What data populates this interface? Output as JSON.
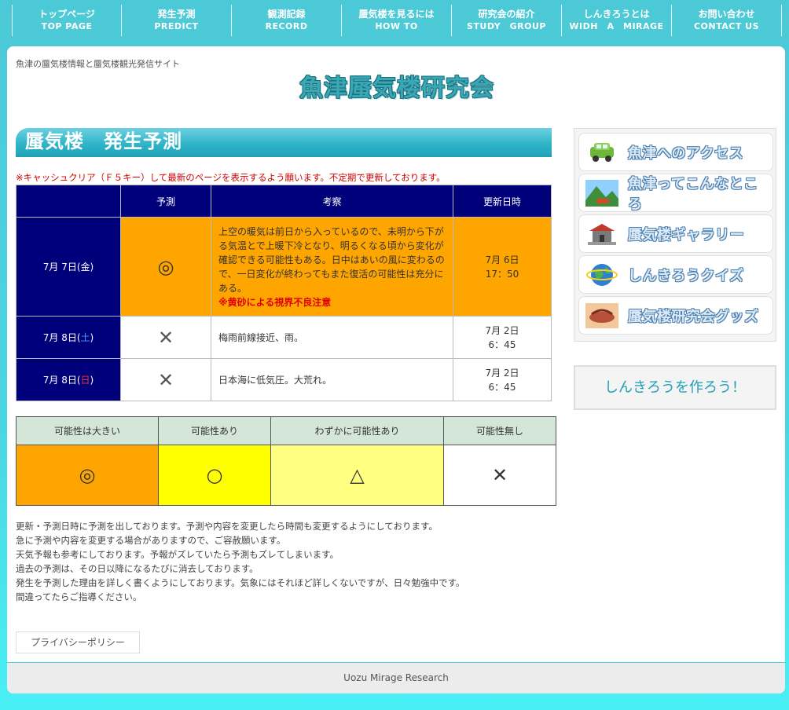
{
  "nav": [
    {
      "jp": "トップページ",
      "en": "TOP PAGE"
    },
    {
      "jp": "発生予測",
      "en": "PREDICT"
    },
    {
      "jp": "観測記録",
      "en": "RECORD"
    },
    {
      "jp": "蜃気楼を見るには",
      "en": "HOW TO"
    },
    {
      "jp": "研究会の紹介",
      "en": "STUDY　GROUP"
    },
    {
      "jp": "しんきろうとは",
      "en": "WIDH　A　MIRAGE"
    },
    {
      "jp": "お問い合わせ",
      "en": "CONTACT US"
    }
  ],
  "tagline": "魚津の蜃気楼情報と蜃気楼観光発信サイト",
  "logo_text": "魚津蜃気楼研究会",
  "section_title": "蜃気楼　発生予測",
  "cache_notice": "※キャッシュクリア（Ｆ５キー）して最新のページを表示するよう願います。不定期で更新しております。",
  "forecast": {
    "headers": [
      "",
      "予測",
      "考察",
      "更新日時"
    ],
    "rows": [
      {
        "date_prefix": "7月 7日(",
        "weekday": "金",
        "date_suffix": ")",
        "mark": "◎",
        "desc": "上空の暖気は前日から入っているので、未明から下がる気温とで上暖下冷となり、明るくなる頃から変化が確認できる可能性もある。日中はあいの風に変わるので、一日変化が終わってもまた復活の可能性は充分にある。",
        "warning": "※黄砂による視界不良注意",
        "updated_date": "7月 6日",
        "updated_time": "17：50"
      },
      {
        "date_prefix": "7月 8日(",
        "weekday": "土",
        "date_suffix": ")",
        "mark": "✕",
        "desc": "梅雨前線接近、雨。",
        "updated_date": "7月 2日",
        "updated_time": "6：45"
      },
      {
        "date_prefix": "7月 8日(",
        "weekday": "日",
        "date_suffix": ")",
        "mark": "✕",
        "desc": "日本海に低気圧。大荒れ。",
        "updated_date": "7月 2日",
        "updated_time": "6：45"
      }
    ]
  },
  "legend": {
    "headers": [
      "可能性は大きい",
      "可能性あり",
      "わずかに可能性あり",
      "可能性無し"
    ],
    "marks": [
      "◎",
      "○",
      "△",
      "✕"
    ],
    "colors": [
      "#ffa500",
      "#ffff00",
      "#ffff80",
      "#ffffff"
    ]
  },
  "notes": [
    "更新・予測日時に予測を出しております。予測や内容を変更したら時間も変更するようにしております。",
    "急に予測や内容を変更する場合がありますので、ご容赦願います。",
    "天気予報も参考にしております。予報がズレていたら予測もズレてしまいます。",
    "過去の予測は、その日以降になるたびに消去しております。",
    "発生を予測した理由を詳しく書くようにしております。気象にはそれほど詳しくないですが、日々勉強中です。",
    "間違ってたらご指導ください。"
  ],
  "privacy_label": "プライバシーポリシー",
  "footer": "Uozu Mirage Research",
  "sidebar": [
    {
      "label": "魚津へのアクセス",
      "icon": "car-icon"
    },
    {
      "label": "魚津ってこんなところ",
      "icon": "landscape-icon"
    },
    {
      "label": "蜃気楼ギャラリー",
      "icon": "castle-icon"
    },
    {
      "label": "しんきろうクイズ",
      "icon": "globe-icon"
    },
    {
      "label": "蜃気楼研究会グッズ",
      "icon": "goods-icon"
    }
  ],
  "make_button": "しんきろうを作ろう！",
  "colors": {
    "accent": "#1fa0b4",
    "navy": "#00007a",
    "orange": "#ffa500",
    "notice_red": "#d00000"
  }
}
